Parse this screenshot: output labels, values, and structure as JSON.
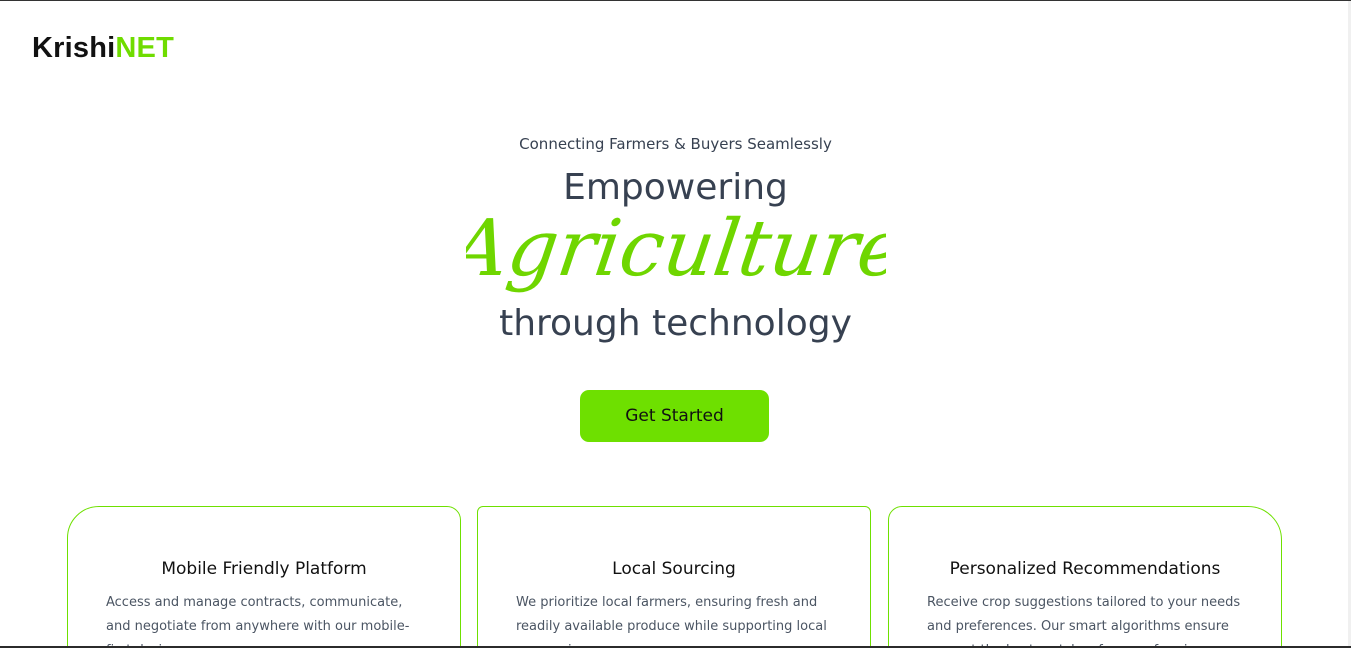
{
  "brand": {
    "name_part1": "Krishi",
    "name_part2": "NET",
    "accent": "#6ee000"
  },
  "hero": {
    "tagline": "Connecting Farmers & Buyers Seamlessly",
    "line1": "Empowering",
    "script_word": "Agriculture",
    "line3": "through technology",
    "cta_label": "Get Started"
  },
  "features": [
    {
      "title": "Mobile Friendly Platform",
      "text": "Access and manage contracts, communicate, and negotiate from anywhere with our mobile-first design."
    },
    {
      "title": "Local Sourcing",
      "text": "We prioritize local farmers, ensuring fresh and readily available produce while supporting local economies."
    },
    {
      "title": "Personalized Recommendations",
      "text": "Receive crop suggestions tailored to your needs and preferences. Our smart algorithms ensure you get the best matches for your farming."
    }
  ]
}
